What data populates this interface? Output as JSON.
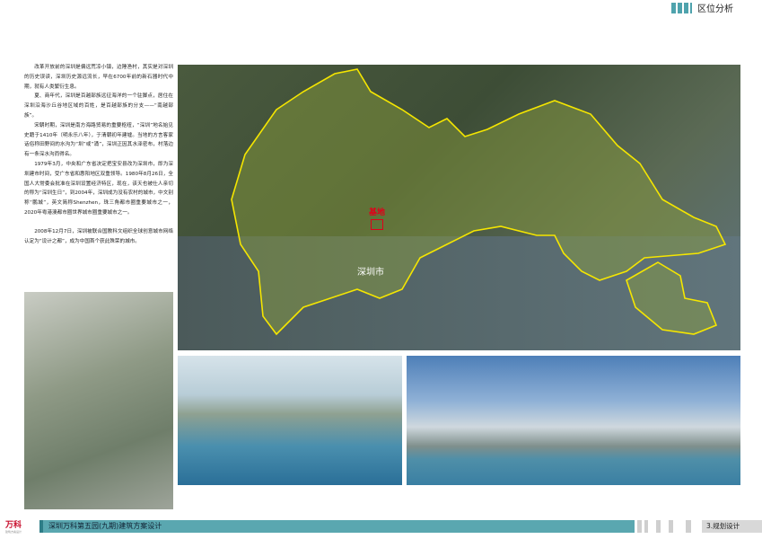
{
  "header": {
    "title": "区位分析",
    "accent": "#4fa3ad"
  },
  "intro": {
    "paragraphs": [
      "改革开放前的深圳是偏远荒凉小镇，边陲渔村，其实是对深圳的历史误读，深圳历史源远流长，早在6700年前的新石器时代中期，就有人类繁衍生息。",
      "夏、商年代，深圳是百越部族远征海洋的一个驻脚点，居住在深圳沿海沙丘谷地区域的百姓，是百越部族的分支——“南越部族”。",
      "宋朝时期，深圳是南方海路贸易的重要枢纽，“深圳”地名始见史籍于1410年（明永乐八年），于清朝初年建墟。当地的方言客家话俗称田野间的水沟为“圳”或“涌”，深圳正因其水泽密布，村落边有一条深水沟而得名。",
      "1979年3月，中央和广东省决定把宝安县改为深圳市，即为深圳建市时间，受广东省和惠阳地区双重领导。1980年8月26日，全国人大常委会批准在深圳设置经济特区，现在，该天也被仕人亲切的称为“深圳生日”，到2004年，深圳成为没有农村的城市，中文别称“鹏城”，英文简称Shenzhen，珠三角都市圈重要城市之一，2020年粤港澳都市圈世界城市圈重要城市之一。",
      "2008年12月7日，深圳被联合国教科文组织全球创意城市网络认定为“设计之都”，成为中国首个获此殊荣的城市。"
    ]
  },
  "map": {
    "city_label": "深圳市",
    "site_label": "基地",
    "boundary_color": "#f5e600",
    "site_color": "#e0001a"
  },
  "footer": {
    "logo": "万科",
    "logo_sub": "建筑方案设计",
    "project": "深圳万科第五园(九期)建筑方案设计",
    "section": "3.规划设计",
    "bar_color": "#5aa7b0"
  }
}
